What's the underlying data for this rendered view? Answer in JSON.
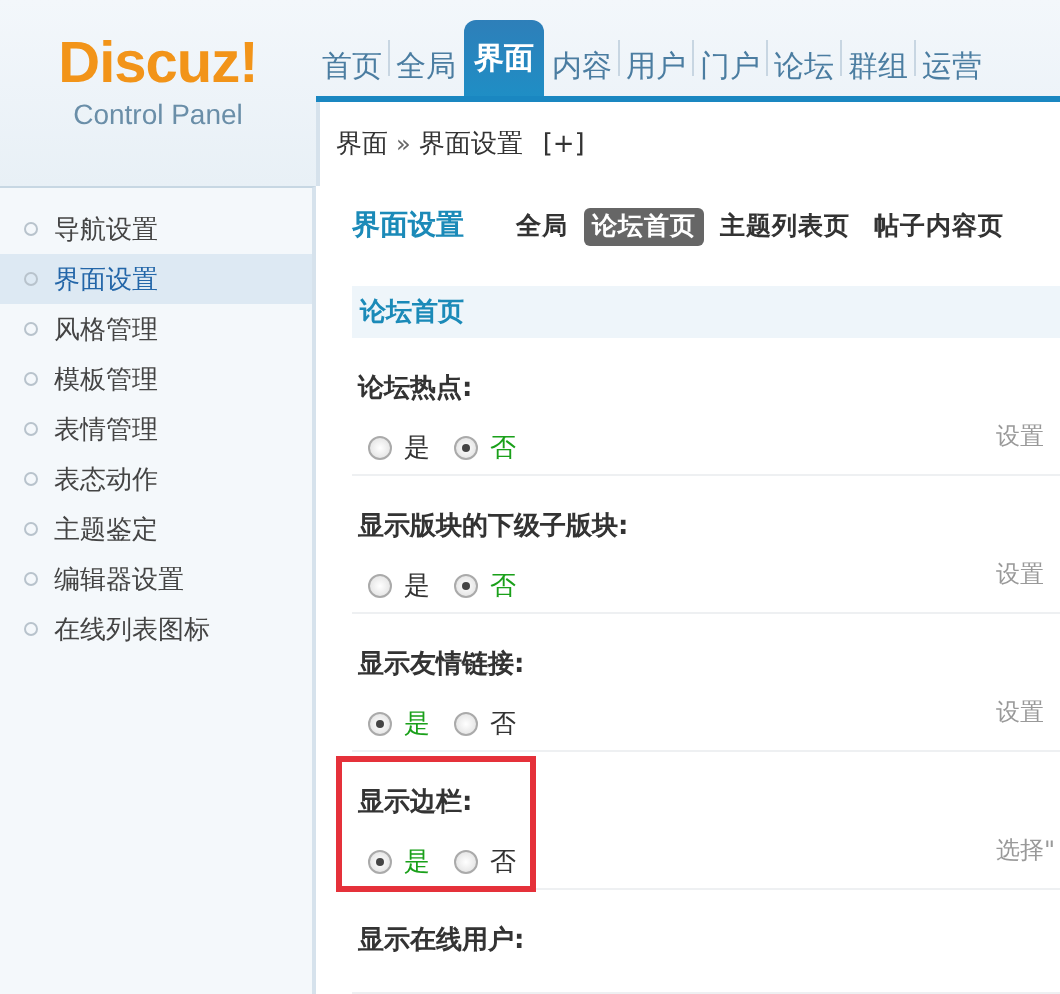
{
  "logo": {
    "name": "Discuz!",
    "subtitle": "Control Panel"
  },
  "nav_tabs": [
    {
      "label": "首页",
      "selected": false
    },
    {
      "label": "全局",
      "selected": false
    },
    {
      "label": "界面",
      "selected": true
    },
    {
      "label": "内容",
      "selected": false
    },
    {
      "label": "用户",
      "selected": false
    },
    {
      "label": "门户",
      "selected": false
    },
    {
      "label": "论坛",
      "selected": false
    },
    {
      "label": "群组",
      "selected": false
    },
    {
      "label": "运营",
      "selected": false
    }
  ],
  "breadcrumb": {
    "parent": "界面",
    "separator": "»",
    "current": "界面设置",
    "add": "[+]"
  },
  "sidebar": {
    "items": [
      {
        "label": "导航设置",
        "selected": false
      },
      {
        "label": "界面设置",
        "selected": true
      },
      {
        "label": "风格管理",
        "selected": false
      },
      {
        "label": "模板管理",
        "selected": false
      },
      {
        "label": "表情管理",
        "selected": false
      },
      {
        "label": "表态动作",
        "selected": false
      },
      {
        "label": "主题鉴定",
        "selected": false
      },
      {
        "label": "编辑器设置",
        "selected": false
      },
      {
        "label": "在线列表图标",
        "selected": false
      }
    ]
  },
  "page_title": "界面设置",
  "sub_tabs": [
    {
      "label": "全局",
      "selected": false
    },
    {
      "label": "论坛首页",
      "selected": true
    },
    {
      "label": "主题列表页",
      "selected": false
    },
    {
      "label": "帖子内容页",
      "selected": false
    }
  ],
  "section_title": "论坛首页",
  "settings": [
    {
      "label": "论坛热点:",
      "options": [
        {
          "label": "是",
          "selected": false
        },
        {
          "label": "否",
          "selected": true
        }
      ],
      "hint": "设置",
      "highlighted": false
    },
    {
      "label": "显示版块的下级子版块:",
      "options": [
        {
          "label": "是",
          "selected": false
        },
        {
          "label": "否",
          "selected": true
        }
      ],
      "hint": "设置",
      "highlighted": false
    },
    {
      "label": "显示友情链接:",
      "options": [
        {
          "label": "是",
          "selected": true
        },
        {
          "label": "否",
          "selected": false
        }
      ],
      "hint": "设置",
      "highlighted": false
    },
    {
      "label": "显示边栏:",
      "options": [
        {
          "label": "是",
          "selected": true
        },
        {
          "label": "否",
          "selected": false
        }
      ],
      "hint": "选择\"",
      "highlighted": true
    },
    {
      "label": "显示在线用户:"
    }
  ]
}
